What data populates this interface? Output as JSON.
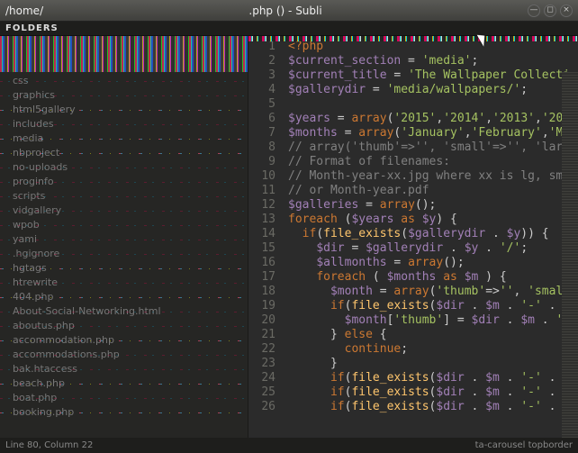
{
  "window": {
    "title_left": "/home/",
    "title_mid": ".php (",
    "title_right": ") - Subli",
    "min": "—",
    "max": "◻",
    "close": "×"
  },
  "folders_label": "FOLDERS",
  "sidebar": {
    "items": [
      {
        "label": "css",
        "bright": false
      },
      {
        "label": "graphics",
        "bright": false
      },
      {
        "label": "html5gallery",
        "bright": true
      },
      {
        "label": "includes",
        "bright": false
      },
      {
        "label": "media",
        "bright": true
      },
      {
        "label": "nbproject",
        "bright": true
      },
      {
        "label": "no-uploads",
        "bright": false
      },
      {
        "label": "proginfo",
        "bright": false
      },
      {
        "label": "scripts",
        "bright": false
      },
      {
        "label": "vidgallery",
        "bright": false
      },
      {
        "label": "wpob",
        "bright": false
      },
      {
        "label": "yami",
        "bright": false
      },
      {
        "label": ".hgignore",
        "bright": false
      },
      {
        "label": "hgtags",
        "bright": true
      },
      {
        "label": "htrewrite",
        "bright": false
      },
      {
        "label": "404.php",
        "bright": true
      },
      {
        "label": "About-Social-Networking.html",
        "bright": false
      },
      {
        "label": "aboutus.php",
        "bright": false
      },
      {
        "label": "accommodation.php",
        "bright": true
      },
      {
        "label": "accommodations.php",
        "bright": false
      },
      {
        "label": "bak.htaccess",
        "bright": false
      },
      {
        "label": "beach.php",
        "bright": true
      },
      {
        "label": "boat.php",
        "bright": false
      },
      {
        "label": "booking.php",
        "bright": true
      }
    ]
  },
  "status": {
    "left": "Line 80, Column 22",
    "right": "ta-carousel topborder"
  },
  "code": {
    "lines": [
      {
        "n": 1,
        "t": [
          [
            "kw",
            "<?php"
          ]
        ]
      },
      {
        "n": 2,
        "t": [
          [
            "var",
            "$current_section"
          ],
          [
            "op",
            " = "
          ],
          [
            "str",
            "'media'"
          ],
          [
            "op",
            ";"
          ]
        ]
      },
      {
        "n": 3,
        "t": [
          [
            "var",
            "$current_title"
          ],
          [
            "op",
            " = "
          ],
          [
            "str",
            "'The Wallpaper Collecti"
          ]
        ]
      },
      {
        "n": 4,
        "t": [
          [
            "var",
            "$gallerydir"
          ],
          [
            "op",
            " = "
          ],
          [
            "str",
            "'media/wallpapers/'"
          ],
          [
            "op",
            ";"
          ]
        ]
      },
      {
        "n": 5,
        "t": []
      },
      {
        "n": 6,
        "t": [
          [
            "var",
            "$years"
          ],
          [
            "op",
            " = "
          ],
          [
            "kw",
            "array"
          ],
          [
            "op",
            "("
          ],
          [
            "str",
            "'2015'"
          ],
          [
            "op",
            ","
          ],
          [
            "str",
            "'2014'"
          ],
          [
            "op",
            ","
          ],
          [
            "str",
            "'2013'"
          ],
          [
            "op",
            ","
          ],
          [
            "str",
            "'201"
          ]
        ]
      },
      {
        "n": 7,
        "t": [
          [
            "var",
            "$months"
          ],
          [
            "op",
            " = "
          ],
          [
            "kw",
            "array"
          ],
          [
            "op",
            "("
          ],
          [
            "str",
            "'January'"
          ],
          [
            "op",
            ","
          ],
          [
            "str",
            "'February'"
          ],
          [
            "op",
            ","
          ],
          [
            "str",
            "'Ma"
          ]
        ]
      },
      {
        "n": 8,
        "t": [
          [
            "cmt",
            "// array('thumb'=>'', 'small'=>'', 'larg"
          ]
        ]
      },
      {
        "n": 9,
        "t": [
          [
            "cmt",
            "// Format of filenames:"
          ]
        ]
      },
      {
        "n": 10,
        "t": [
          [
            "cmt",
            "// Month-year-xx.jpg where xx is lg, sm"
          ]
        ]
      },
      {
        "n": 11,
        "t": [
          [
            "cmt",
            "// or Month-year.pdf"
          ]
        ]
      },
      {
        "n": 12,
        "t": [
          [
            "var",
            "$galleries"
          ],
          [
            "op",
            " = "
          ],
          [
            "kw",
            "array"
          ],
          [
            "op",
            "();"
          ]
        ]
      },
      {
        "n": 13,
        "t": [
          [
            "kw",
            "foreach"
          ],
          [
            "op",
            " ("
          ],
          [
            "var",
            "$years"
          ],
          [
            "op",
            " "
          ],
          [
            "kw",
            "as"
          ],
          [
            "op",
            " "
          ],
          [
            "var",
            "$y"
          ],
          [
            "op",
            ") {"
          ]
        ]
      },
      {
        "n": 14,
        "t": [
          [
            "op",
            "  "
          ],
          [
            "kw",
            "if"
          ],
          [
            "op",
            "("
          ],
          [
            "fn",
            "file_exists"
          ],
          [
            "op",
            "("
          ],
          [
            "var",
            "$gallerydir"
          ],
          [
            "op",
            " . "
          ],
          [
            "var",
            "$y"
          ],
          [
            "op",
            ")) {"
          ]
        ]
      },
      {
        "n": 15,
        "t": [
          [
            "op",
            "    "
          ],
          [
            "var",
            "$dir"
          ],
          [
            "op",
            " = "
          ],
          [
            "var",
            "$gallerydir"
          ],
          [
            "op",
            " . "
          ],
          [
            "var",
            "$y"
          ],
          [
            "op",
            " . "
          ],
          [
            "str",
            "'/'"
          ],
          [
            "op",
            ";"
          ]
        ]
      },
      {
        "n": 16,
        "t": [
          [
            "op",
            "    "
          ],
          [
            "var",
            "$allmonths"
          ],
          [
            "op",
            " = "
          ],
          [
            "kw",
            "array"
          ],
          [
            "op",
            "();"
          ]
        ]
      },
      {
        "n": 17,
        "t": [
          [
            "op",
            "    "
          ],
          [
            "kw",
            "foreach"
          ],
          [
            "op",
            " ( "
          ],
          [
            "var",
            "$months"
          ],
          [
            "op",
            " "
          ],
          [
            "kw",
            "as"
          ],
          [
            "op",
            " "
          ],
          [
            "var",
            "$m"
          ],
          [
            "op",
            " ) {"
          ]
        ]
      },
      {
        "n": 18,
        "t": [
          [
            "op",
            "      "
          ],
          [
            "var",
            "$month"
          ],
          [
            "op",
            " = "
          ],
          [
            "kw",
            "array"
          ],
          [
            "op",
            "("
          ],
          [
            "str",
            "'thumb'"
          ],
          [
            "op",
            "=>"
          ],
          [
            "str",
            "''"
          ],
          [
            "op",
            ", "
          ],
          [
            "str",
            "'small"
          ]
        ]
      },
      {
        "n": 19,
        "t": [
          [
            "op",
            "      "
          ],
          [
            "kw",
            "if"
          ],
          [
            "op",
            "("
          ],
          [
            "fn",
            "file_exists"
          ],
          [
            "op",
            "("
          ],
          [
            "var",
            "$dir"
          ],
          [
            "op",
            " . "
          ],
          [
            "var",
            "$m"
          ],
          [
            "op",
            " . "
          ],
          [
            "str",
            "'-'"
          ],
          [
            "op",
            " . "
          ],
          [
            "var",
            "$"
          ]
        ]
      },
      {
        "n": 20,
        "t": [
          [
            "op",
            "        "
          ],
          [
            "var",
            "$month"
          ],
          [
            "op",
            "["
          ],
          [
            "str",
            "'thumb'"
          ],
          [
            "op",
            "] = "
          ],
          [
            "var",
            "$dir"
          ],
          [
            "op",
            " . "
          ],
          [
            "var",
            "$m"
          ],
          [
            "op",
            " . "
          ],
          [
            "str",
            "'"
          ]
        ]
      },
      {
        "n": 21,
        "t": [
          [
            "op",
            "      } "
          ],
          [
            "kw",
            "else"
          ],
          [
            "op",
            " {"
          ]
        ]
      },
      {
        "n": 22,
        "t": [
          [
            "op",
            "        "
          ],
          [
            "kw",
            "continue"
          ],
          [
            "op",
            ";"
          ]
        ]
      },
      {
        "n": 23,
        "t": [
          [
            "op",
            "      }"
          ]
        ]
      },
      {
        "n": 24,
        "t": [
          [
            "op",
            "      "
          ],
          [
            "kw",
            "if"
          ],
          [
            "op",
            "("
          ],
          [
            "fn",
            "file_exists"
          ],
          [
            "op",
            "("
          ],
          [
            "var",
            "$dir"
          ],
          [
            "op",
            " . "
          ],
          [
            "var",
            "$m"
          ],
          [
            "op",
            " . "
          ],
          [
            "str",
            "'-'"
          ],
          [
            "op",
            " . "
          ],
          [
            "var",
            "$"
          ]
        ]
      },
      {
        "n": 25,
        "t": [
          [
            "op",
            "      "
          ],
          [
            "kw",
            "if"
          ],
          [
            "op",
            "("
          ],
          [
            "fn",
            "file_exists"
          ],
          [
            "op",
            "("
          ],
          [
            "var",
            "$dir"
          ],
          [
            "op",
            " . "
          ],
          [
            "var",
            "$m"
          ],
          [
            "op",
            " . "
          ],
          [
            "str",
            "'-'"
          ],
          [
            "op",
            " . "
          ],
          [
            "var",
            "$"
          ]
        ]
      },
      {
        "n": 26,
        "t": [
          [
            "op",
            "      "
          ],
          [
            "kw",
            "if"
          ],
          [
            "op",
            "("
          ],
          [
            "fn",
            "file_exists"
          ],
          [
            "op",
            "("
          ],
          [
            "var",
            "$dir"
          ],
          [
            "op",
            " . "
          ],
          [
            "var",
            "$m"
          ],
          [
            "op",
            " . "
          ],
          [
            "str",
            "'-'"
          ],
          [
            "op",
            " . "
          ],
          [
            "var",
            "$"
          ]
        ]
      }
    ]
  }
}
